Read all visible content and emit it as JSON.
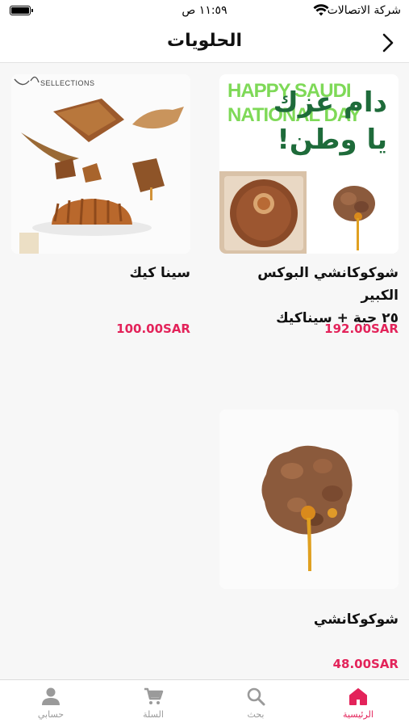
{
  "status_bar": {
    "carrier": "شركة الاتصالات",
    "time": "١١:٥٩ ص",
    "battery_level": 1.0
  },
  "header": {
    "title": "الحلويات",
    "back_icon": "chevron-right-icon"
  },
  "products": [
    {
      "name_line1": "شوكوكانشي البوكس الكبير",
      "name_line2": "٢٥ حبة + سيناكيك",
      "price": "192.00SAR",
      "banner_text_en_1": "HAPPY SAUDI",
      "banner_text_en_2": "NATIONAL DAY",
      "banner_text_ar_1": "دام عزك",
      "banner_text_ar_2": "يا وطن!"
    },
    {
      "name_line1": "سينا كيك",
      "price": "100.00SAR",
      "brand_text": "SELLECTIONS"
    },
    {
      "name_line1": "شوكوكانشي",
      "price": "48.00SAR"
    }
  ],
  "tabs": [
    {
      "label": "الرئيسية",
      "icon": "home-icon",
      "active": true
    },
    {
      "label": "بحث",
      "icon": "search-icon",
      "active": false
    },
    {
      "label": "السلة",
      "icon": "cart-icon",
      "active": false
    },
    {
      "label": "حسابي",
      "icon": "person-icon",
      "active": false
    }
  ],
  "colors": {
    "accent": "#e3235a",
    "inactive_tab": "#9a9a9a",
    "banner_green": "#7ed957",
    "banner_dark_green": "#1e6b3a"
  }
}
